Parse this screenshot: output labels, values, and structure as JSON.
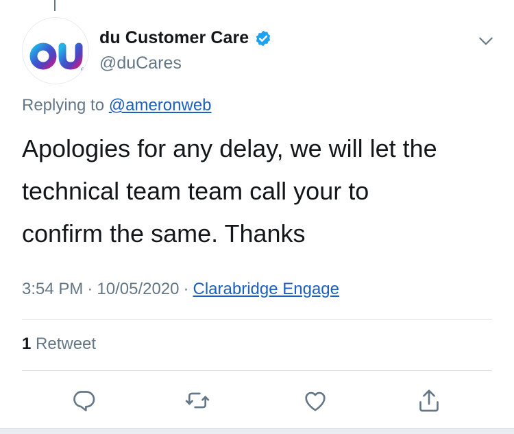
{
  "tweet": {
    "author": {
      "display_name": "du Customer Care",
      "handle": "@duCares",
      "verified": true,
      "avatar_logo": "du"
    },
    "replying_prefix": "Replying to ",
    "replying_to": "@ameronweb",
    "text_lines": [
      "Apologies for any delay, we will let the",
      "technical team team call your to",
      "confirm the same. Thanks"
    ],
    "time": "3:54 PM",
    "date": "10/05/2020",
    "separator": "·",
    "source": "Clarabridge Engage",
    "retweet_count": "1",
    "retweet_label": "Retweet"
  },
  "actions": [
    {
      "name": "reply",
      "icon": "reply-icon"
    },
    {
      "name": "retweet",
      "icon": "retweet-icon"
    },
    {
      "name": "like",
      "icon": "heart-icon"
    },
    {
      "name": "share",
      "icon": "share-icon"
    }
  ],
  "colors": {
    "text": "#14171a",
    "secondary": "#657786",
    "link": "#1b5fc1",
    "verified": "#1da1f2",
    "logo_gradient": [
      "#23b5e6",
      "#5b3dbb",
      "#c0208a"
    ]
  }
}
